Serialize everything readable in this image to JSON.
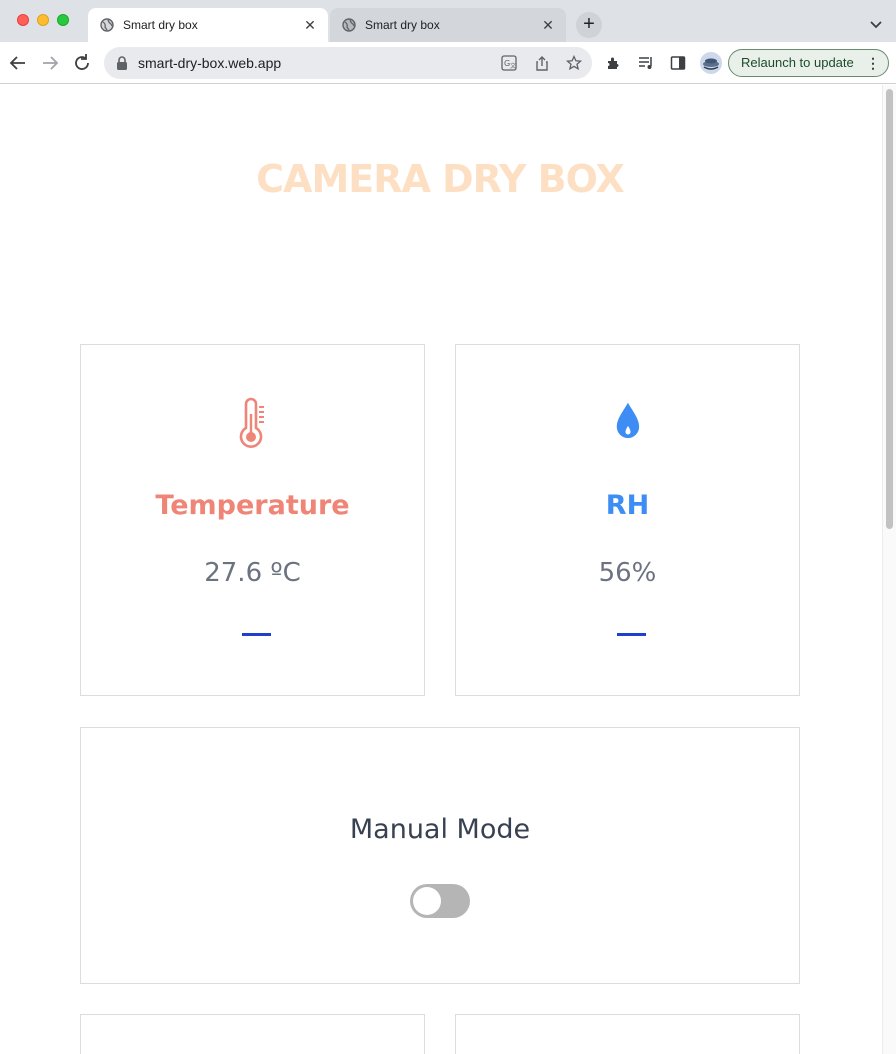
{
  "browser": {
    "tabs": [
      {
        "title": "Smart dry box",
        "active": true
      },
      {
        "title": "Smart dry box",
        "active": false
      }
    ],
    "new_tab_label": "+",
    "close_glyph": "✕",
    "address": "smart-dry-box.web.app",
    "relaunch_label": "Relaunch to update",
    "menu_glyph": "⋮"
  },
  "page": {
    "title": "CAMERA DRY BOX",
    "title_color": "#fde0c4",
    "sensors": {
      "temperature": {
        "label": "Temperature",
        "value": "27.6 ºC",
        "icon": "thermometer-icon",
        "color": "#ef8576"
      },
      "humidity": {
        "label": "RH",
        "value": "56%",
        "icon": "droplet-icon",
        "color": "#3d8df5"
      }
    },
    "manual_mode": {
      "label": "Manual Mode",
      "enabled": false
    }
  }
}
